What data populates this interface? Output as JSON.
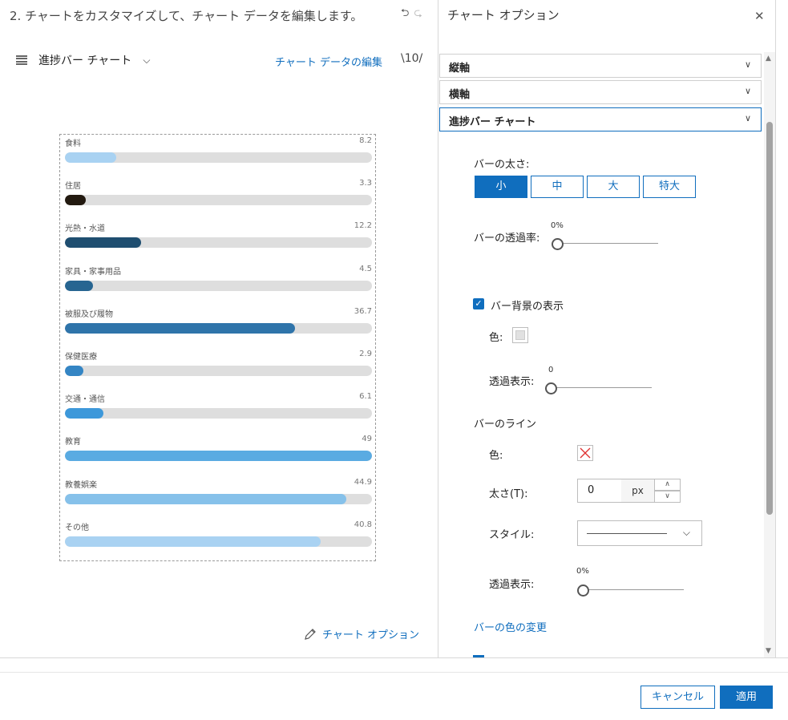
{
  "header": {
    "step_title": "2. チャートをカスタマイズして、チャート データを編集します。",
    "undo_icon": "undo-icon",
    "redo_icon": "redo-icon",
    "chart_type_label": "進捗バー チャート",
    "edit_data_label": "チャート データの編集",
    "edit_data_icon_text": "\\10/"
  },
  "chart_data": {
    "type": "bar",
    "orientation": "horizontal",
    "style": "progress-bar",
    "max_value": 49,
    "track_color": "#dedede",
    "categories": [
      "食料",
      "住居",
      "光熱・水道",
      "家具・家事用品",
      "被服及び履物",
      "保健医療",
      "交通・通信",
      "教育",
      "教養娯楽",
      "その他"
    ],
    "values": [
      8.2,
      3.3,
      12.2,
      4.5,
      36.7,
      2.9,
      6.1,
      49,
      44.9,
      40.8
    ],
    "value_labels": [
      "8.2",
      "3.3",
      "12.2",
      "4.5",
      "36.7",
      "2.9",
      "6.1",
      "49",
      "44.9",
      "40.8"
    ],
    "colors": [
      "#a9d2f2",
      "#231a10",
      "#1f4e70",
      "#276591",
      "#2f74aa",
      "#3485c4",
      "#3d98da",
      "#5aabe2",
      "#86c1ea",
      "#a9d2f2"
    ]
  },
  "chart_options_link": "チャート オプション",
  "panel": {
    "title": "チャート オプション",
    "close_icon": "close-icon",
    "accordion": [
      {
        "label": "縦軸"
      },
      {
        "label": "横軸"
      },
      {
        "label": "進捗バー チャート"
      }
    ],
    "bar_thickness_label": "バーの太さ:",
    "thickness_options": [
      "小",
      "中",
      "大",
      "特大"
    ],
    "thickness_selected": "小",
    "bar_opacity_label": "バーの透過率:",
    "bar_opacity_value": "0%",
    "show_bg_label": "バー背景の表示",
    "show_bg_checked": true,
    "bg_color_label": "色:",
    "bg_color": "#e1e1e1",
    "bg_opacity_label": "透過表示:",
    "bg_opacity_value": "0",
    "bar_line_label": "バーのライン",
    "line_color_label": "色:",
    "line_width_label": "太さ(T):",
    "line_width_value": "0",
    "line_width_unit": "px",
    "line_style_label": "スタイル:",
    "line_opacity_label": "透過表示:",
    "line_opacity_value": "0%",
    "change_color_link": "バーの色の変更"
  },
  "footer": {
    "cancel_label": "キャンセル",
    "apply_label": "適用"
  },
  "colors": {
    "accent": "#106ebe"
  }
}
